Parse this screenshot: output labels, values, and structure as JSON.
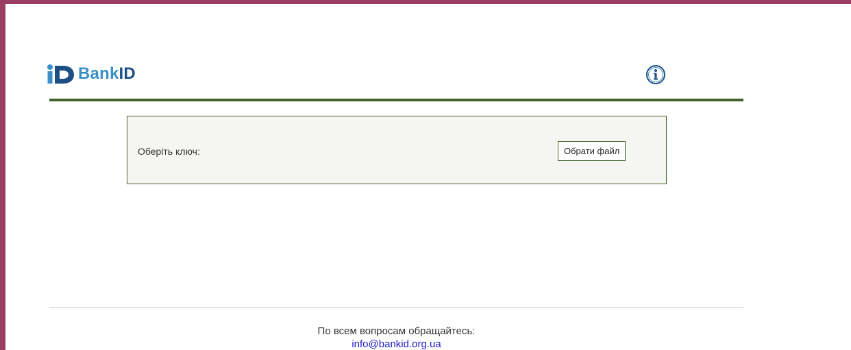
{
  "header": {
    "logo_bank": "Bank",
    "logo_id": "ID",
    "info_icon": "info-circle-icon"
  },
  "key_panel": {
    "label": "Оберіть ключ:",
    "file_button_label": "Обрати файл"
  },
  "footer": {
    "contact_text": "По всем вопросам обращайтесь:",
    "email": "info@bankid.org.ua"
  },
  "colors": {
    "frame_border": "#9a3d63",
    "accent_green": "#44622c",
    "logo_light_blue": "#3a8fc7",
    "logo_dark_blue": "#1c4f84",
    "link_blue": "#1a1acc"
  }
}
